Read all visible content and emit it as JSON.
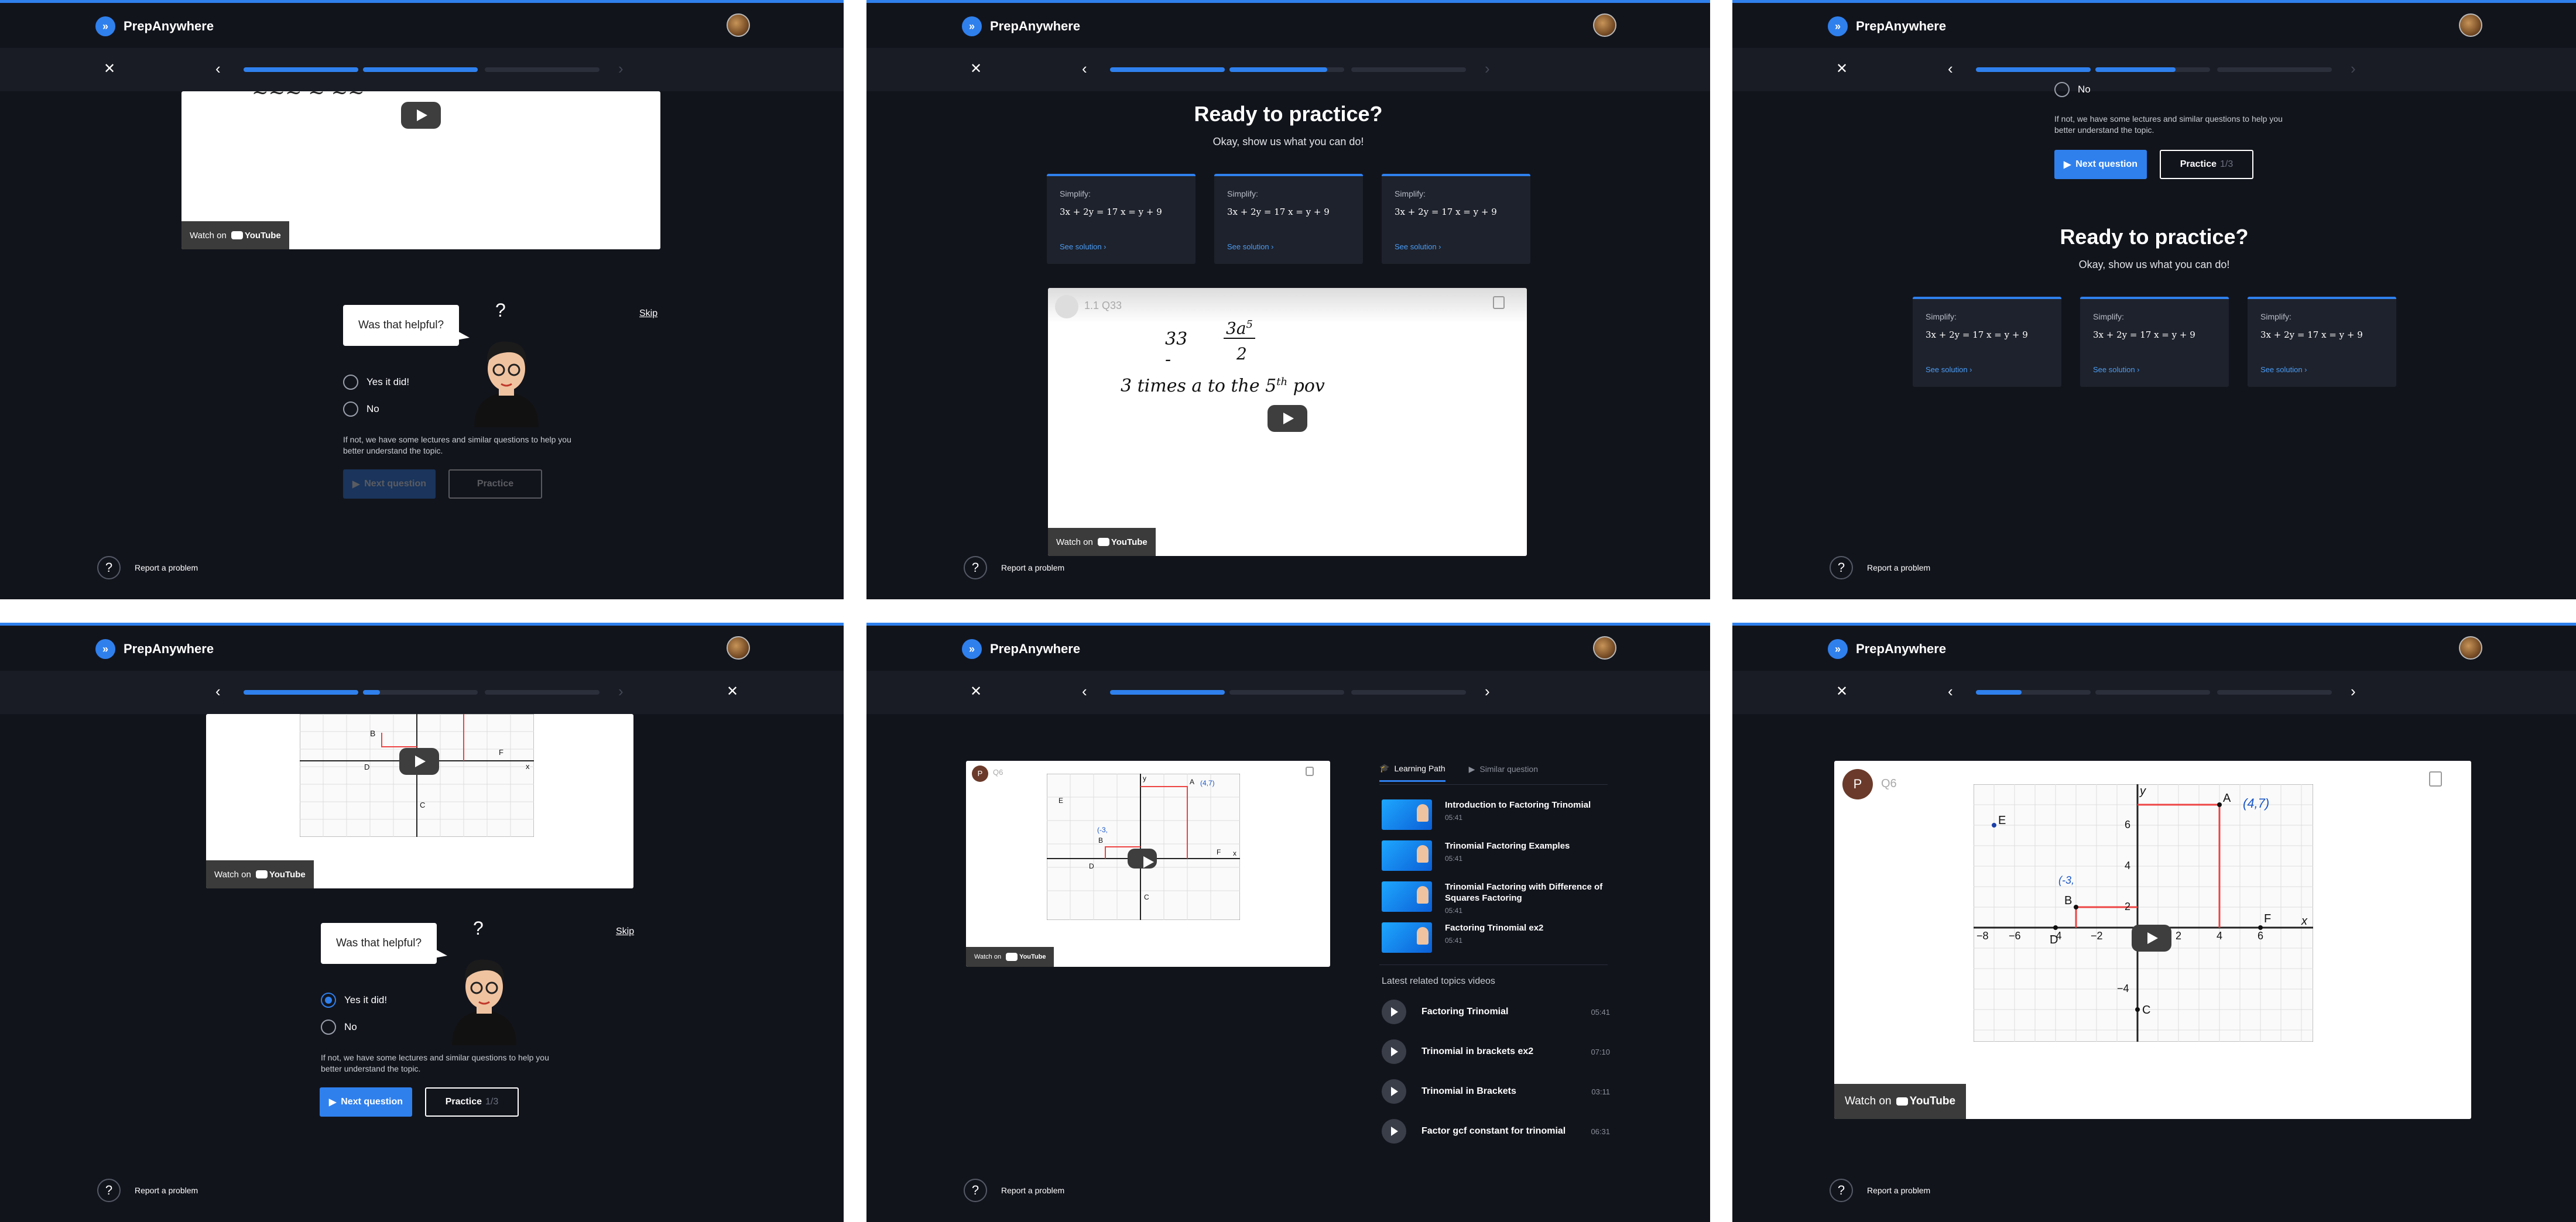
{
  "app": {
    "brand": "PrepAnywhere",
    "brand_icon": "double-chevron-icon",
    "accent": "#2f80ed",
    "background": "#12141c"
  },
  "common": {
    "report": "Report a problem",
    "help_glyph": "?",
    "close_glyph": "✕",
    "prev_glyph": "‹",
    "next_glyph": "›",
    "watch_on": "Watch on",
    "youtube": "YouTube"
  },
  "feedback": {
    "question": "Was that helpful?",
    "qmark": "?",
    "skip": "Skip",
    "yes": "Yes it did!",
    "no": "No",
    "note": "If not, we have some lectures and similar questions to help you better understand the topic.",
    "next": "Next question",
    "practice": "Practice",
    "practice_count": "1/3"
  },
  "practice": {
    "title": "Ready to practice?",
    "subtitle": "Okay, show us what you can do!",
    "cards": [
      {
        "label": "Simplify:",
        "equation": "3x + 2y = 17 x = y + 9",
        "link": "See solution ›"
      },
      {
        "label": "Simplify:",
        "equation": "3x + 2y = 17 x = y + 9",
        "link": "See solution ›"
      },
      {
        "label": "Simplify:",
        "equation": "3x + 2y = 17 x = y + 9",
        "link": "See solution ›"
      }
    ],
    "video_title": "1.1 Q33",
    "whiteboard_1": "33 -",
    "whiteboard_num": "3a",
    "whiteboard_exp": "5",
    "whiteboard_den": "2",
    "whiteboard_2": "3 times a to the 5",
    "whiteboard_2_sup": "th",
    "whiteboard_2_end": "pov"
  },
  "graph": {
    "channel_initial": "P",
    "video_title": "Q6",
    "point_a_label": "(4,7)",
    "point_b_label": "(-3,",
    "labels": {
      "a": "A",
      "b": "B",
      "c": "C",
      "d": "D",
      "e": "E",
      "f": "F",
      "x": "x",
      "y": "y"
    },
    "x_ticks": [
      "−8",
      "−6",
      "−4",
      "−2",
      "2",
      "4",
      "6"
    ],
    "y_ticks": [
      "6",
      "4",
      "2",
      "−4"
    ]
  },
  "learning": {
    "tab_active": "Learning Path",
    "tab_inactive": "Similar question",
    "path": [
      {
        "title": "Introduction to Factoring Trinomial",
        "time": "05:41"
      },
      {
        "title": "Trinomial Factoring Examples",
        "time": "05:41"
      },
      {
        "title": "Trinomial Factoring with Difference of Squares Factoring",
        "time": "05:41"
      },
      {
        "title": "Factoring Trinomial ex2",
        "time": "05:41"
      }
    ],
    "related_heading": "Latest related topics videos",
    "related": [
      {
        "title": "Factoring Trinomial",
        "time": "05:41"
      },
      {
        "title": "Trinomial in brackets ex2",
        "time": "07:10"
      },
      {
        "title": "Trinomial in Brackets",
        "time": "03:11"
      },
      {
        "title": "Factor gcf constant for trinomial",
        "time": "06:31"
      }
    ]
  },
  "progress": {
    "p1": [
      1.0,
      1.0,
      0.0
    ],
    "p2": [
      1.0,
      0.85,
      0.0
    ],
    "p3": [
      1.0,
      0.7,
      0.0
    ],
    "p4": [
      1.0,
      0.15,
      0.0
    ],
    "p5": [
      1.0,
      0.0,
      0.0
    ],
    "p6": [
      0.4,
      0.0,
      0.0
    ]
  }
}
